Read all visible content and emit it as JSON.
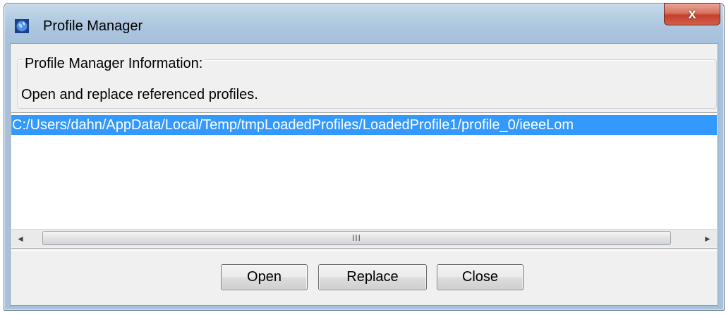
{
  "window": {
    "title": "Profile Manager",
    "close_glyph": "x"
  },
  "info": {
    "legend": "Profile Manager Information:",
    "description": "Open and replace referenced profiles."
  },
  "profiles": {
    "items": [
      "C:/Users/dahn/AppData/Local/Temp/tmpLoadedProfiles/LoadedProfile1/profile_0/ieeeLom"
    ],
    "selected_index": 0
  },
  "scrollbar": {
    "left_arrow": "◄",
    "right_arrow": "►",
    "grip": "III"
  },
  "buttons": {
    "open_label": "Open",
    "replace_label": "Replace",
    "close_label": "Close"
  },
  "colors": {
    "selection": "#3399ff",
    "close_button": "#c4402a"
  }
}
